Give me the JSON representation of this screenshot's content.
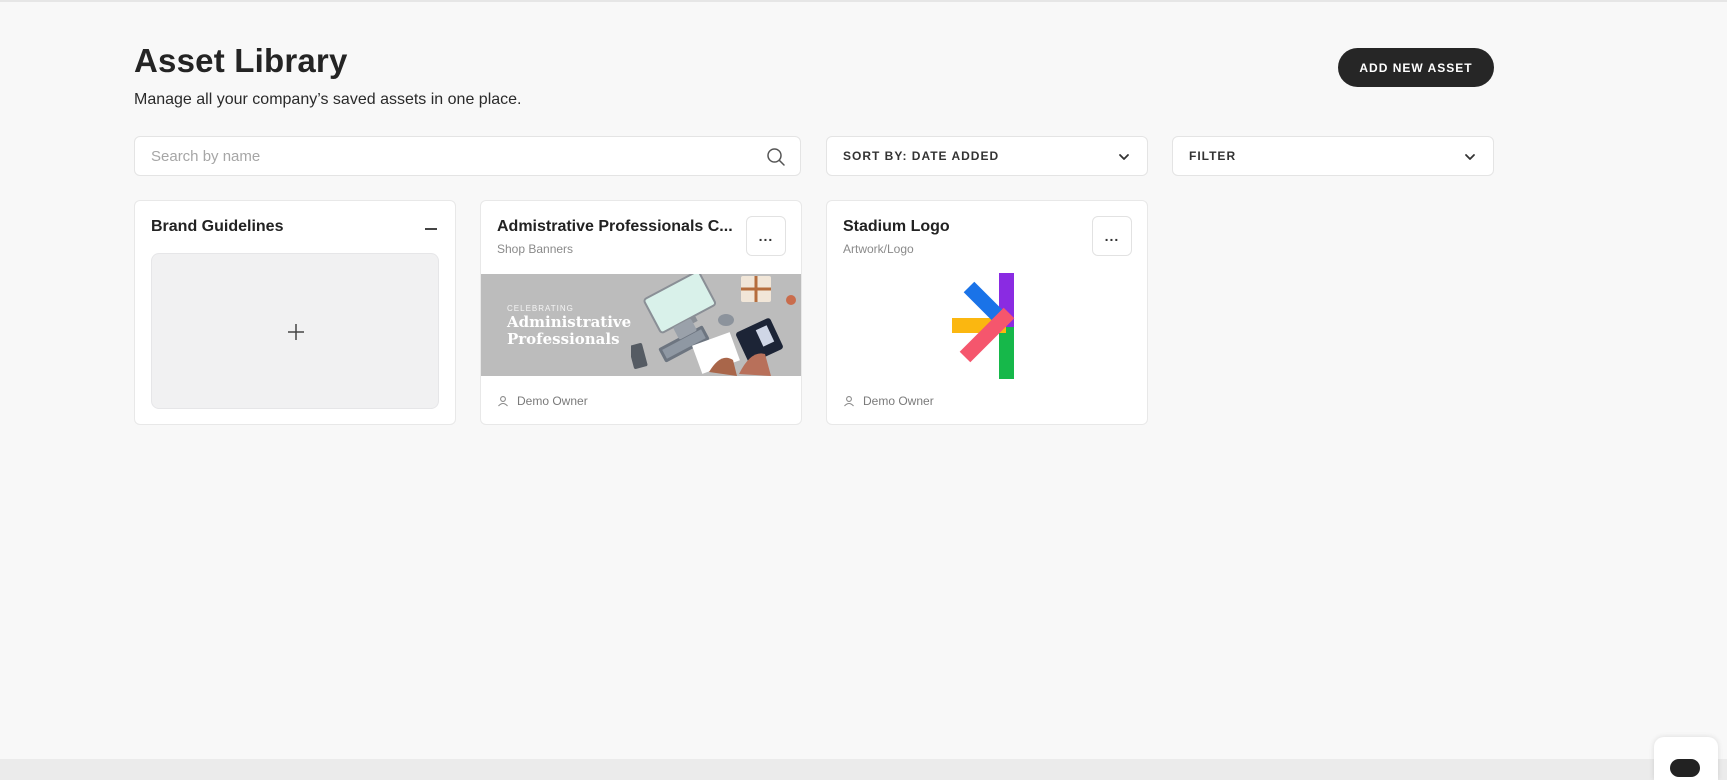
{
  "header": {
    "title": "Asset Library",
    "subtitle": "Manage all your company’s saved assets in one place.",
    "add_button_label": "ADD NEW ASSET"
  },
  "toolbar": {
    "search_placeholder": "Search by name",
    "search_value": "",
    "sort_label": "SORT BY: DATE ADDED",
    "filter_label": "FILTER"
  },
  "cards": {
    "brand": {
      "title": "Brand Guidelines"
    },
    "admin": {
      "title": "Admistrative Professionals C...",
      "subtitle": "Shop Banners",
      "banner_small": "CELEBRATING",
      "banner_big": "Administrative Professionals",
      "owner": "Demo Owner",
      "more_label": "..."
    },
    "stadium": {
      "title": "Stadium Logo",
      "subtitle": "Artwork/Logo",
      "owner": "Demo Owner",
      "more_label": "..."
    }
  },
  "colors": {
    "primary_button": "#262626",
    "logo_blue": "#1a73e8",
    "logo_purple": "#8a2be2",
    "logo_yellow": "#fbb710",
    "logo_pink": "#f5566d",
    "logo_green": "#16b84a"
  },
  "icons": {
    "search": "search-icon",
    "sort_chevron": "chevron-down-icon",
    "filter_chevron": "chevron-down-icon",
    "collapse": "minus-icon",
    "add": "plus-icon",
    "more": "more-horizontal-icon",
    "owner": "user-icon",
    "chat": "chat-icon"
  }
}
